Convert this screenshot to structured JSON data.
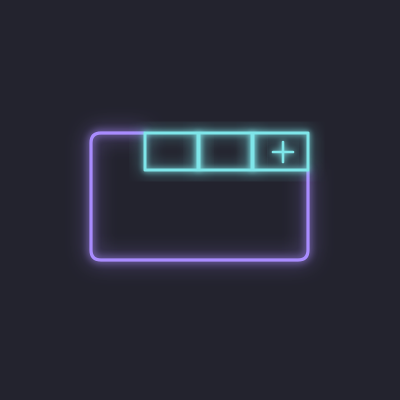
{
  "colors": {
    "background": "#23232e",
    "frame": "#a98cff",
    "tabs": "#7fe6ea",
    "glow_frame": "#7d5cff",
    "glow_tabs": "#45d6e0"
  },
  "icon": {
    "name": "window-tabs-add-icon",
    "tabs": [
      {
        "name": "tab-1"
      },
      {
        "name": "tab-2"
      },
      {
        "name": "tab-add",
        "glyph": "plus-icon"
      }
    ]
  }
}
